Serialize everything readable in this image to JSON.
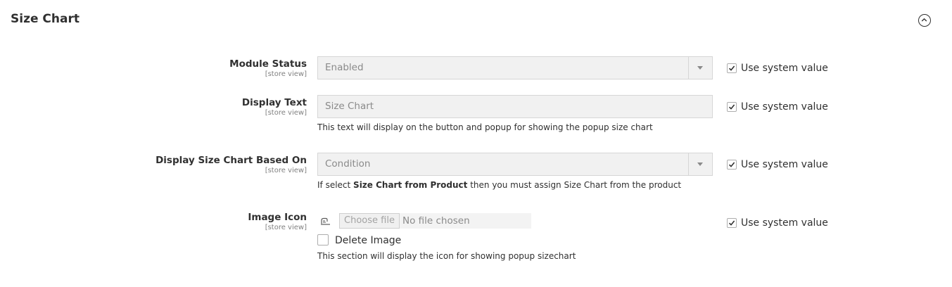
{
  "section": {
    "title": "Size Chart"
  },
  "common": {
    "use_system_value": "Use system value",
    "scope": "[store view]"
  },
  "fields": {
    "module_status": {
      "label": "Module Status",
      "value": "Enabled"
    },
    "display_text": {
      "label": "Display Text",
      "value": "Size Chart",
      "note": "This text will display on the button and popup for showing the popup size chart"
    },
    "based_on": {
      "label": "Display Size Chart Based On",
      "value": "Condition",
      "note_prefix": "If select ",
      "note_bold": "Size Chart from Product",
      "note_suffix": " then you must assign Size Chart from the product"
    },
    "image_icon": {
      "label": "Image Icon",
      "choose_file": "Choose file",
      "no_file": "No file chosen",
      "delete_label": "Delete Image",
      "note": "This section will display the icon for showing popup sizechart"
    }
  }
}
